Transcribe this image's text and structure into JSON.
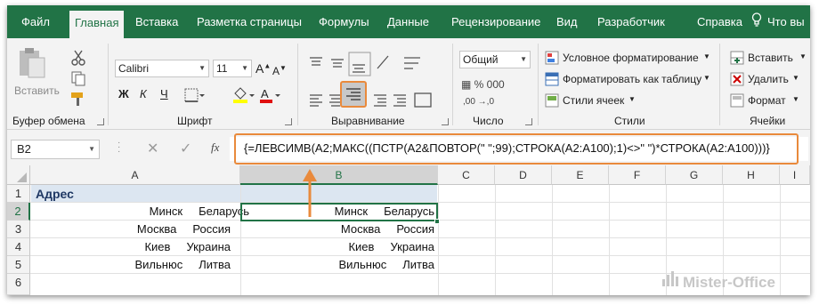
{
  "colors": {
    "accent": "#217346",
    "highlight": "#e98a3c",
    "header_fill": "#dce6f1"
  },
  "tabs": [
    "Файл",
    "Главная",
    "Вставка",
    "Разметка страницы",
    "Формулы",
    "Данные",
    "Рецензирование",
    "Вид",
    "Разработчик",
    "Справка"
  ],
  "tellme_icon": "lightbulb-icon",
  "tellme_label": "Что вы",
  "ribbon": {
    "clipboard": {
      "paste_label": "Вставить",
      "group_label": "Буфер обмена"
    },
    "font": {
      "name": "Calibri",
      "size": "11",
      "group_label": "Шрифт",
      "bold": "Ж",
      "italic": "К",
      "underline": "Ч"
    },
    "alignment": {
      "group_label": "Выравнивание"
    },
    "number": {
      "format": "Общий",
      "group_label": "Число"
    },
    "styles": {
      "items": [
        "Условное форматирование",
        "Форматировать как таблицу",
        "Стили ячеек"
      ],
      "group_label": "Стили"
    },
    "cells": {
      "items": [
        "Вставить",
        "Удалить",
        "Формат"
      ],
      "group_label": "Ячейки"
    }
  },
  "formula_bar": {
    "name_box": "B2",
    "fx": "fx",
    "formula": "{=ЛЕВСИМВ(A2;МАКС((ПСТР(A2&ПОВТОР(\" \";99);СТРОКА(A2:A100);1)<>\" \")*СТРОКА(A2:A100)))}"
  },
  "sheet": {
    "columns": [
      "A",
      "B",
      "C",
      "D",
      "E",
      "F",
      "G",
      "H",
      "I"
    ],
    "rows": [
      "1",
      "2",
      "3",
      "4",
      "5",
      "6"
    ],
    "a1": "Адрес",
    "col_a": [
      "Минск     Беларусь",
      "Москва     Россия",
      "Киев     Украина",
      "Вильнюс     Литва"
    ],
    "col_b": [
      "Минск     Беларусь",
      "Москва     Россия",
      "Киев     Украина",
      "Вильнюс     Литва"
    ]
  },
  "watermark": "Mister-Office"
}
